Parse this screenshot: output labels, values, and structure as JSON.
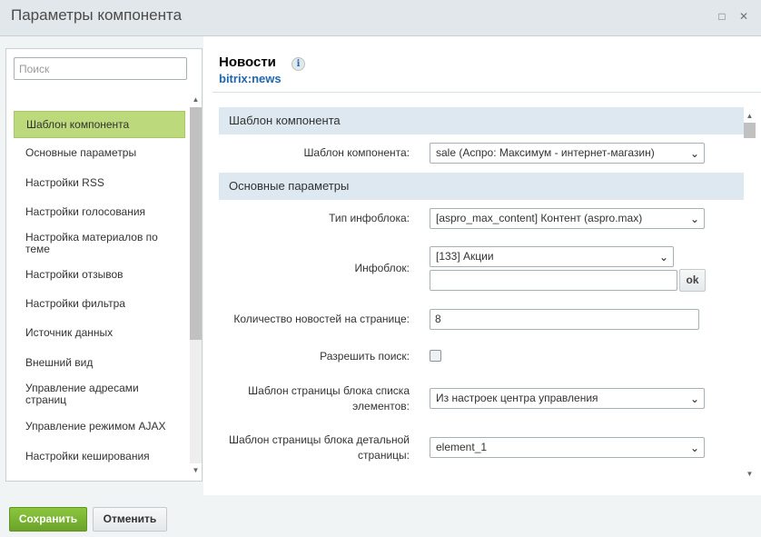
{
  "window": {
    "title": "Параметры компонента",
    "minimize_icon": "□",
    "close_icon": "✕"
  },
  "search": {
    "placeholder": "Поиск"
  },
  "sidebar": {
    "items": [
      {
        "label": "Шаблон компонента",
        "active": true
      },
      {
        "label": "Основные параметры"
      },
      {
        "label": "Настройки RSS"
      },
      {
        "label": "Настройки голосования"
      },
      {
        "label": "Настройка материалов по теме"
      },
      {
        "label": "Настройки отзывов"
      },
      {
        "label": "Настройки фильтра"
      },
      {
        "label": "Источник данных"
      },
      {
        "label": "Внешний вид"
      },
      {
        "label": "Управление адресами страниц"
      },
      {
        "label": "Управление режимом AJAX"
      },
      {
        "label": "Настройки кеширования"
      }
    ]
  },
  "component": {
    "name": "Новости",
    "code": "bitrix:news",
    "info_icon": "i"
  },
  "sections": {
    "template": "Шаблон компонента",
    "main": "Основные параметры"
  },
  "fields": {
    "template": {
      "label": "Шаблон компонента:",
      "value": "sale (Аспро: Максимум - интернет-магазин)"
    },
    "iblock_type": {
      "label": "Тип инфоблока:",
      "value": "[aspro_max_content] Контент (aspro.max)"
    },
    "iblock": {
      "label": "Инфоблок:",
      "value": "[133] Акции",
      "extra_value": "",
      "ok_label": "ok"
    },
    "news_count": {
      "label": "Количество новостей на странице:",
      "value": "8"
    },
    "allow_search": {
      "label": "Разрешить поиск:",
      "checked": false
    },
    "list_template": {
      "label": "Шаблон страницы блока списка элементов:",
      "value": "Из настроек центра управления"
    },
    "detail_template": {
      "label": "Шаблон страницы блока детальной страницы:",
      "value": "element_1"
    }
  },
  "footer": {
    "save_label": "Сохранить",
    "cancel_label": "Отменить"
  },
  "colors": {
    "active_item": "#bcd97c",
    "section_bg": "#dde8f0",
    "save_button": "#7ab433",
    "component_code": "#2067b0"
  }
}
